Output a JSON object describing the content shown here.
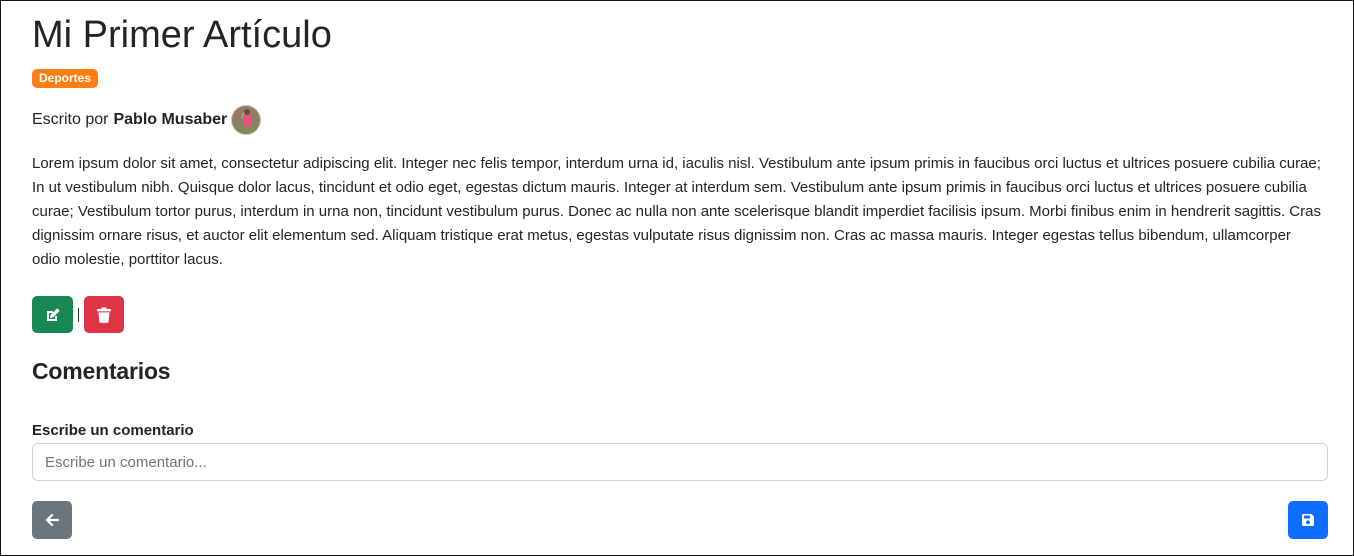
{
  "article": {
    "title": "Mi Primer Artículo",
    "category": "Deportes",
    "byline_prefix": "Escrito por",
    "author": "Pablo Musaber",
    "body": "Lorem ipsum dolor sit amet, consectetur adipiscing elit. Integer nec felis tempor, interdum urna id, iaculis nisl. Vestibulum ante ipsum primis in faucibus orci luctus et ultrices posuere cubilia curae; In ut vestibulum nibh. Quisque dolor lacus, tincidunt et odio eget, egestas dictum mauris. Integer at interdum sem. Vestibulum ante ipsum primis in faucibus orci luctus et ultrices posuere cubilia curae; Vestibulum tortor purus, interdum in urna non, tincidunt vestibulum purus. Donec ac nulla non ante scelerisque blandit imperdiet facilisis ipsum. Morbi finibus enim in hendrerit sagittis. Cras dignissim ornare risus, et auctor elit elementum sed. Aliquam tristique erat metus, egestas vulputate risus dignissim non. Cras ac massa mauris. Integer egestas tellus bibendum, ullamcorper odio molestie, porttitor lacus.",
    "separator": "|"
  },
  "actions": {
    "edit_icon": "edit-icon",
    "delete_icon": "trash-icon"
  },
  "comments": {
    "heading": "Comentarios",
    "field_label": "Escribe un comentario",
    "placeholder": "Escribe un comentario...",
    "value": ""
  },
  "footer": {
    "back_icon": "arrow-left-icon",
    "save_icon": "floppy-disk-icon"
  },
  "colors": {
    "badge": "#fd7e14",
    "edit_button": "#198754",
    "delete_button": "#dc3545",
    "back_button": "#6c757d",
    "save_button": "#0d6efd",
    "text": "#212529"
  }
}
